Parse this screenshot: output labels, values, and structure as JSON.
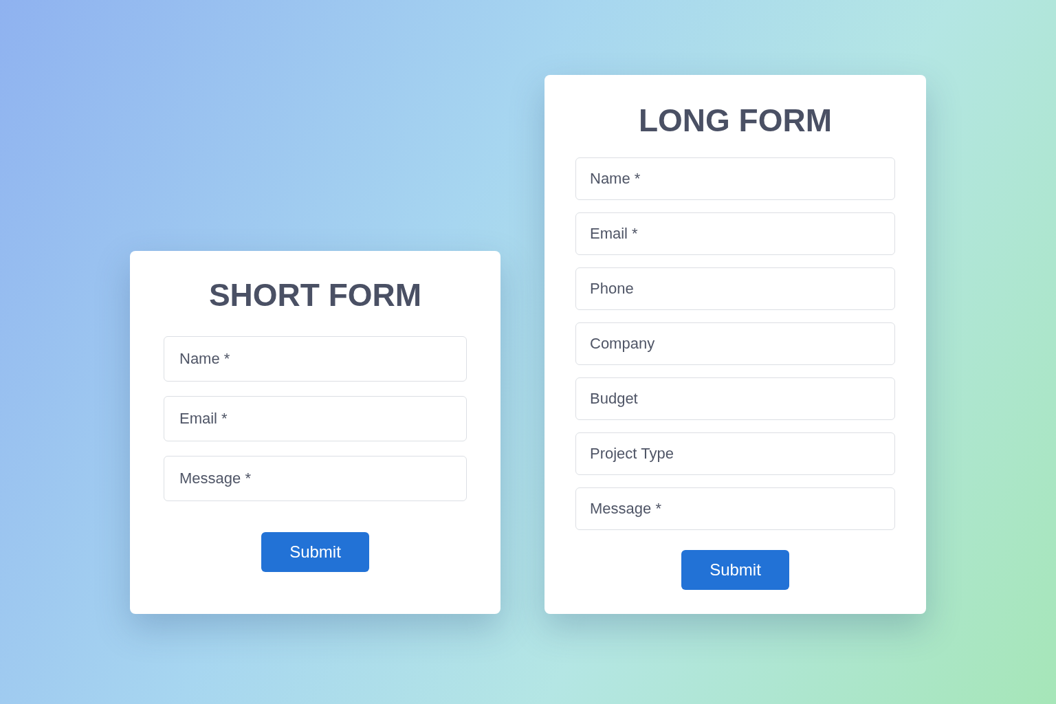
{
  "forms": [
    {
      "title": "SHORT FORM",
      "fields": [
        {
          "placeholder": "Name *"
        },
        {
          "placeholder": "Email *"
        },
        {
          "placeholder": "Message *"
        }
      ],
      "button": "Submit"
    },
    {
      "title": "LONG FORM",
      "fields": [
        {
          "placeholder": "Name *"
        },
        {
          "placeholder": "Email *"
        },
        {
          "placeholder": "Phone"
        },
        {
          "placeholder": "Company"
        },
        {
          "placeholder": "Budget"
        },
        {
          "placeholder": "Project Type"
        },
        {
          "placeholder": "Message *"
        }
      ],
      "button": "Submit"
    }
  ]
}
